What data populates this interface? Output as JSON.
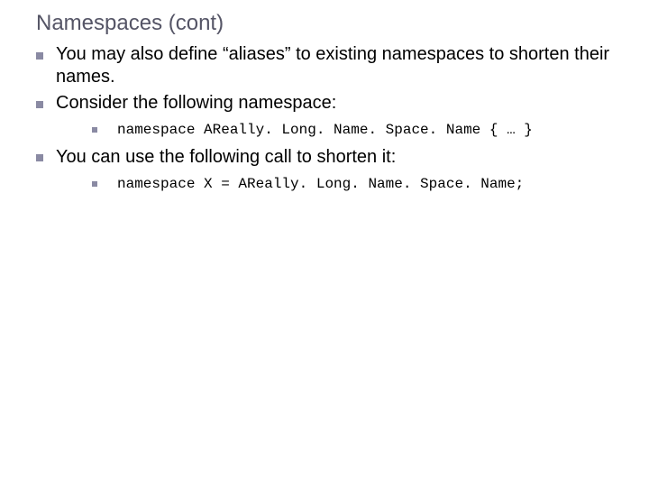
{
  "title": "Namespaces (cont)",
  "bullets": {
    "b1": "You may also define “aliases” to existing namespaces to shorten their names.",
    "b2": "Consider the following namespace:",
    "b2_code": "namespace AReally. Long. Name. Space. Name { … }",
    "b3": "You can use the following call to shorten it:",
    "b3_code": "namespace X = AReally. Long. Name. Space. Name;"
  }
}
